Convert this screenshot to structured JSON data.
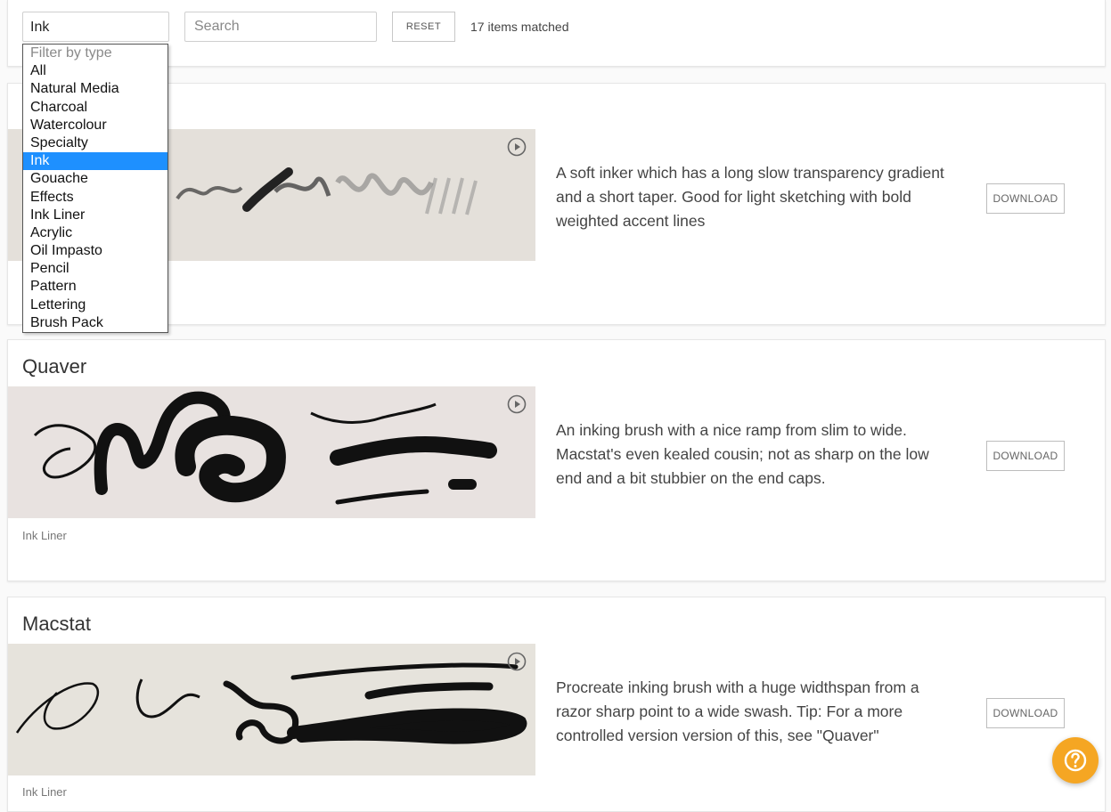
{
  "filter": {
    "selected_value": "Ink",
    "placeholder": "Filter by type",
    "options": [
      "All",
      "Natural Media",
      "Charcoal",
      "Watercolour",
      "Specialty",
      "Ink",
      "Gouache",
      "Effects",
      "Ink Liner",
      "Acrylic",
      "Oil Impasto",
      "Pencil",
      "Pattern",
      "Lettering",
      "Brush Pack"
    ]
  },
  "search": {
    "placeholder": "Search",
    "value": ""
  },
  "reset_label": "RESET",
  "match_count": "17 items matched",
  "brushes": [
    {
      "title": "",
      "description": "A soft inker which has a long slow transparency gradient and a short taper. Good for light sketching with bold weighted accent lines",
      "download_label": "DOWNLOAD",
      "tag": ""
    },
    {
      "title": "Quaver",
      "description": "An inking brush with a nice ramp from slim to wide. Macstat's even kealed cousin; not as sharp on the low end and a bit stubbier on the end caps.",
      "download_label": "DOWNLOAD",
      "tag": "Ink Liner"
    },
    {
      "title": "Macstat",
      "description": "Procreate inking brush with a huge widthspan from a razor sharp point to a wide swash. Tip: For a more controlled version version of this, see \"Quaver\"",
      "download_label": "DOWNLOAD",
      "tag": "Ink Liner"
    }
  ],
  "icons": {
    "play": "play-circle-icon",
    "help": "question-circle-icon"
  },
  "colors": {
    "selected_option": "#1e90ff",
    "help_button": "#f5a623"
  }
}
